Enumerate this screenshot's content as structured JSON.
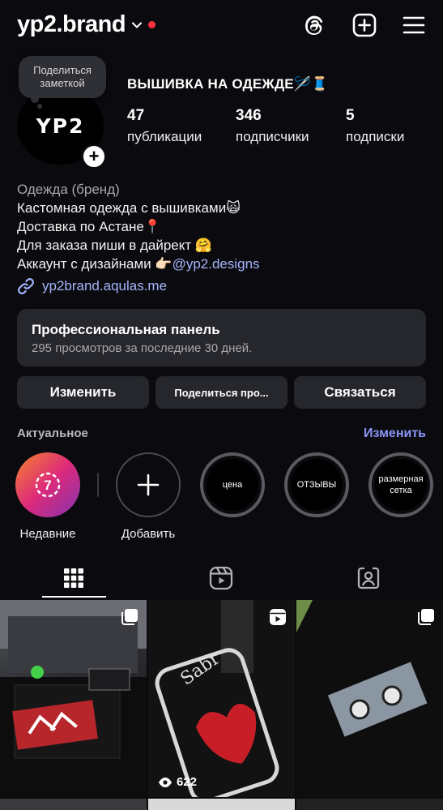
{
  "header": {
    "username": "yp2.brand",
    "icons": [
      "threads-icon",
      "new-post-icon",
      "menu-icon"
    ]
  },
  "profile": {
    "note_bubble": "Поделиться заметкой",
    "avatar_text": "YP2",
    "full_name": "ВЫШИВКА НА ОДЕЖДЕ🪡🧵",
    "stats": [
      {
        "value": "47",
        "label": "публикации"
      },
      {
        "value": "346",
        "label": "подписчики"
      },
      {
        "value": "5",
        "label": "подписки"
      }
    ]
  },
  "bio": {
    "category": "Одежда (бренд)",
    "line1": "Кастомная одежда с вышивками🙀",
    "line2": "Доставка по Астане📍",
    "line3": "Для заказа пиши в дайрект 🤗",
    "line4_prefix": "Аккаунт с дизайнами 👉🏻",
    "line4_mention": "@yp2.designs",
    "link": "yp2brand.aqulas.me"
  },
  "pro_panel": {
    "title": "Профессиональная панель",
    "subtitle": "295 просмотров за последние 30 дней."
  },
  "buttons": {
    "edit": "Изменить",
    "share": "Поделиться про...",
    "contact": "Связаться"
  },
  "highlights": {
    "title": "Актуальное",
    "edit": "Изменить",
    "recent_badge": "7",
    "items": [
      {
        "label": "Недавние",
        "cover": ""
      },
      {
        "label": "Добавить",
        "cover": ""
      },
      {
        "label": "",
        "cover": "цена"
      },
      {
        "label": "",
        "cover": "ОТЗЫВЫ"
      },
      {
        "label": "",
        "cover": "размерная сетка"
      }
    ]
  },
  "tabs": [
    "grid-icon",
    "reels-icon",
    "tagged-icon"
  ],
  "posts": [
    {
      "type": "carousel",
      "views": ""
    },
    {
      "type": "reel",
      "views": "622"
    },
    {
      "type": "carousel",
      "views": ""
    }
  ],
  "colors": {
    "background": "#0b0b0f",
    "card": "#26272c",
    "accent_link": "#a5b4fc",
    "accent_edit": "#8b95f6",
    "notification_dot": "#ff3040"
  }
}
